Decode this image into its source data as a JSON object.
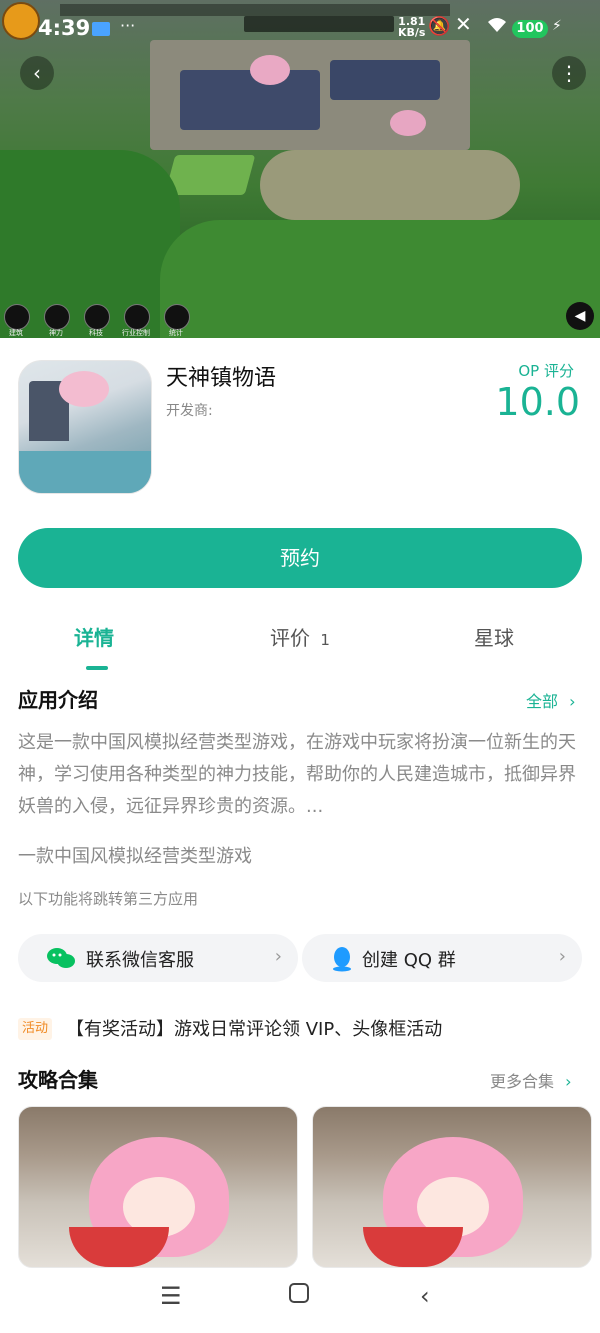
{
  "status_bar": {
    "time": "4:39",
    "net_speed_value": "1.81",
    "net_speed_unit": "KB/s",
    "battery": "100"
  },
  "app": {
    "name": "天神镇物语",
    "developer_label": "开发商:",
    "score_label": "OP 评分",
    "score": "10.0",
    "reserve_button": "预约"
  },
  "tabs": [
    {
      "label": "详情",
      "active": true
    },
    {
      "label": "评价",
      "count": "1"
    },
    {
      "label": "星球"
    }
  ],
  "intro": {
    "title": "应用介绍",
    "more": "全部",
    "text": "这是一款中国风模拟经营类型游戏，在游戏中玩家将扮演一位新生的天神，学习使用各种类型的神力技能，帮助你的人民建造城市，抵御异界妖兽的入侵，远征异界珍贵的资源。...",
    "tagline": "一款中国风模拟经营类型游戏",
    "third_party_note": "以下功能将跳转第三方应用"
  },
  "links": {
    "wechat": "联系微信客服",
    "qq": "创建 QQ 群"
  },
  "activity": {
    "badge": "活动",
    "text": "【有奖活动】游戏日常评论领 VIP、头像框活动"
  },
  "guides": {
    "title": "攻略合集",
    "more": "更多合集"
  },
  "hero_hud": [
    "建筑",
    "神力",
    "科技",
    "行业控制",
    "统计"
  ],
  "colors": {
    "accent": "#1ab394",
    "activity": "#f08a24"
  }
}
